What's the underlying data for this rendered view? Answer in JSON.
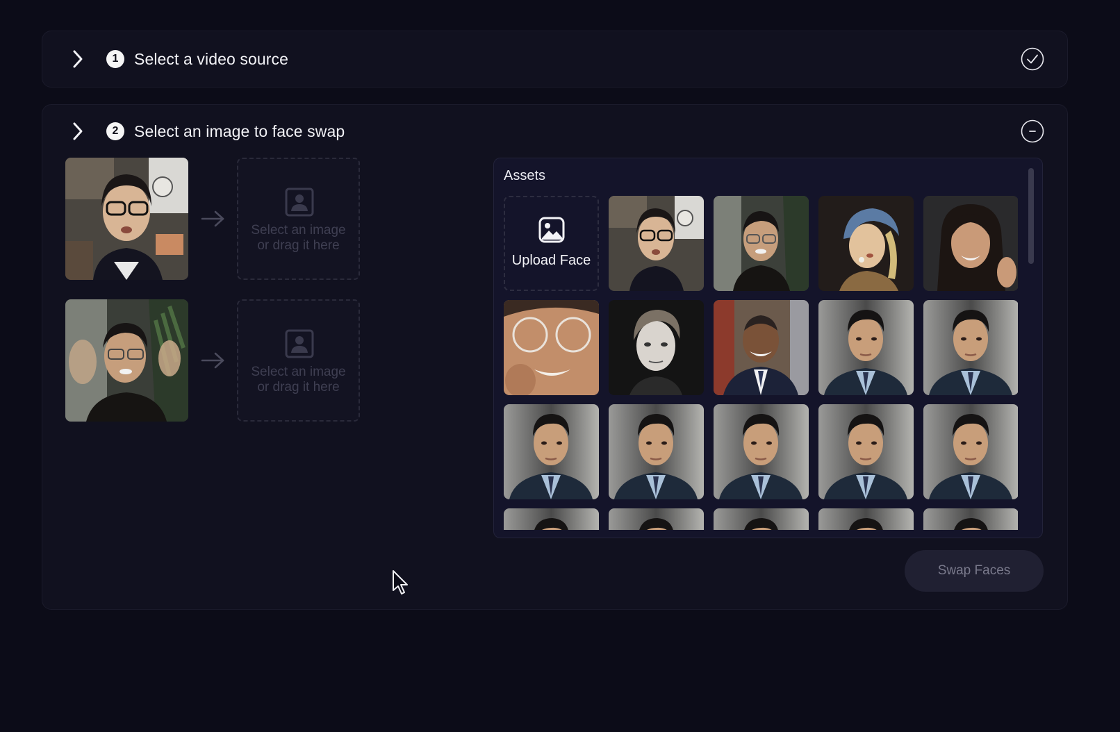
{
  "steps": [
    {
      "number": "1",
      "title": "Select a video source",
      "status": "completed"
    },
    {
      "number": "2",
      "title": "Select an image to face swap",
      "status": "in-progress"
    }
  ],
  "face_rows": [
    {
      "source_face": "man with glasses, black and white jacket",
      "placeholder": "Select an image or drag it here",
      "placeholder_line1": "Select an image",
      "placeholder_line2": "or drag it here"
    },
    {
      "source_face": "man with glasses waving, plants behind",
      "placeholder": "Select an image or drag it here",
      "placeholder_line1": "Select an image",
      "placeholder_line2": "or drag it here"
    }
  ],
  "assets": {
    "title": "Assets",
    "upload_label": "Upload Face",
    "items": [
      "man with glasses",
      "man with glasses smiling",
      "girl with a pearl earring painting",
      "smiling woman with dark hair",
      "close-up woman with glasses",
      "young man black and white portrait",
      "smiling man in suit with flags",
      "man in suit and tie",
      "man in suit and tie",
      "man in suit and tie",
      "man in suit and tie",
      "man in suit and tie",
      "man in suit and tie",
      "man in suit and tie",
      "man in suit and tie",
      "man in suit and tie",
      "man in suit and tie",
      "man in suit and tie",
      "man in suit and tie"
    ]
  },
  "actions": {
    "swap_label": "Swap Faces"
  },
  "colors": {
    "background": "#0c0c18",
    "panel": "#11111f",
    "accent_text": "#f2f2f6",
    "disabled_button": "#202032"
  }
}
